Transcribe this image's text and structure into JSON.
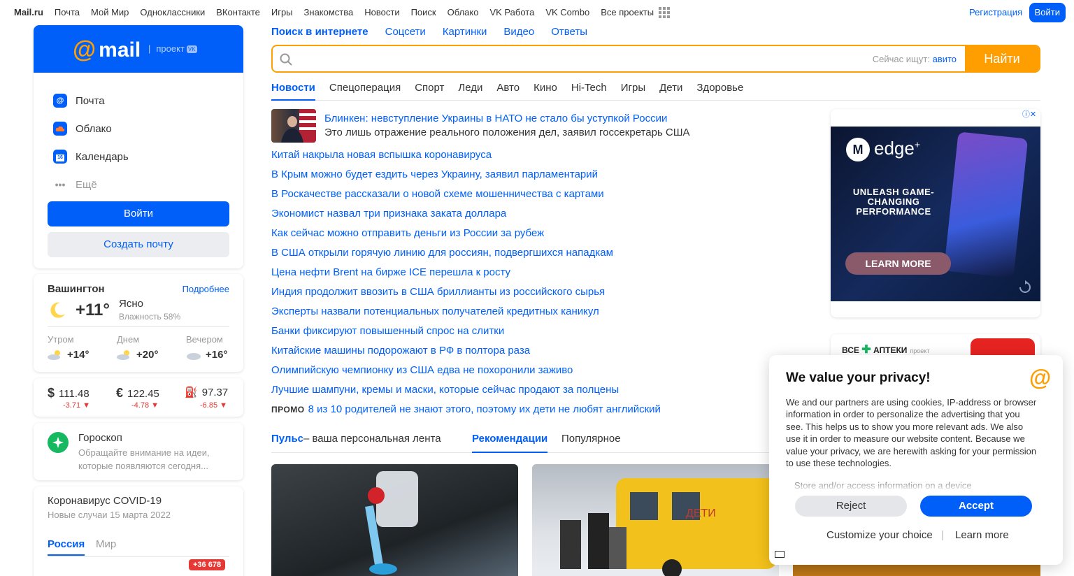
{
  "topnav": {
    "brand": "Mail.ru",
    "links": [
      "Почта",
      "Мой Мир",
      "Одноклассники",
      "ВКонтакте",
      "Игры",
      "Знакомства",
      "Новости",
      "Поиск",
      "Облако",
      "VK Работа",
      "VK Combo",
      "Все проекты"
    ],
    "register": "Регистрация",
    "login": "Войти"
  },
  "mail_card": {
    "logo_text": "mail",
    "project_text": "проект",
    "project_badge": "VK",
    "services": [
      {
        "label": "Почта",
        "icon": "mail-icon"
      },
      {
        "label": "Облако",
        "icon": "cloud-icon"
      },
      {
        "label": "Календарь",
        "icon": "calendar-icon"
      },
      {
        "label": "Ещё",
        "icon": "more-icon"
      }
    ],
    "login_button": "Войти",
    "create_button": "Создать почту"
  },
  "weather": {
    "city": "Вашингтон",
    "more": "Подробнее",
    "temp": "+11°",
    "desc": "Ясно",
    "humidity": "Влажность 58%",
    "periods": [
      {
        "label": "Утром",
        "temp": "+14°"
      },
      {
        "label": "Днем",
        "temp": "+20°"
      },
      {
        "label": "Вечером",
        "temp": "+16°"
      }
    ]
  },
  "rates": [
    {
      "symbol": "$",
      "value": "111.48",
      "change": "-3.71 ▼"
    },
    {
      "symbol": "€",
      "value": "122.45",
      "change": "-4.78 ▼"
    },
    {
      "symbol": "⛽",
      "value": "97.37",
      "change": "-6.85 ▼"
    }
  ],
  "horoscope": {
    "title": "Гороскоп",
    "text": "Обращайте внимание на идеи, которые появляются сегодня..."
  },
  "covid": {
    "title": "Коронавирус COVID-19",
    "subtitle": "Новые случаи 15 марта 2022",
    "tab_russia": "Россия",
    "tab_world": "Мир",
    "badge": "+36 678"
  },
  "search": {
    "tabs": [
      "Поиск в интернете",
      "Соцсети",
      "Картинки",
      "Видео",
      "Ответы"
    ],
    "hint_prefix": "Сейчас ищут:",
    "hint_value": "авито",
    "button": "Найти",
    "placeholder": ""
  },
  "news_tabs": [
    "Новости",
    "Спецоперация",
    "Спорт",
    "Леди",
    "Авто",
    "Кино",
    "Hi-Tech",
    "Игры",
    "Дети",
    "Здоровье"
  ],
  "lead": {
    "title": "Блинкен: невступление Украины в НАТО не стало бы уступкой России",
    "subtitle": "Это лишь отражение реального положения дел, заявил госсекретарь США"
  },
  "news": [
    "Китай накрыла новая вспышка коронавируса",
    "В Крым можно будет ездить через Украину, заявил парламентарий",
    "В Роскачестве рассказали о новой схеме мошенничества с картами",
    "Экономист назвал три признака заката доллара",
    "Как сейчас можно отправить деньги из России за рубеж",
    "В США открыли горячую линию для россиян, подвергшихся нападкам",
    "Цена нефти Brent на бирже ICE перешла к росту",
    "Индия продолжит ввозить в США бриллианты из российского сырья",
    "Эксперты назвали потенциальных получателей кредитных каникул",
    "Банки фиксируют повышенный спрос на слитки",
    "Китайские машины подорожают в РФ в полтора раза",
    "Олимпийскую чемпионку из США едва не похоронили заживо",
    "Лучшие шампуни, кремы и маски, которые сейчас продают за полцены"
  ],
  "promo": {
    "tag": "ПРОМО",
    "text": "8 из 10 родителей не знают этого, поэтому их дети не любят английский"
  },
  "pulse": {
    "brand": "Пульс",
    "desc": "– ваша персональная лента",
    "tab_rec": "Рекомендации",
    "tab_pop": "Популярное"
  },
  "ad1": {
    "brand": "edge",
    "brand_sup": "+",
    "brand_mark": "M",
    "headline": "UNLEASH GAME-CHANGING PERFORMANCE",
    "cta": "LEARN MORE",
    "info": "ⓘ✕"
  },
  "ad2": {
    "logo": "ВСЕ",
    "logo_plus": "✚",
    "logo_tail": "АПТЕКИ",
    "proj": "проект"
  },
  "privacy": {
    "title": "We value your privacy!",
    "logo": "@",
    "body": "We and our partners are using cookies, IP-address or browser information in order to personalize the advertising that you see. This helps us to show you more relevant ads. We also use it in order to measure our website content. Because we value your privacy, we are herewith asking for your permission to use these technologies.",
    "faded": "Store and/or access information on a device",
    "reject": "Reject",
    "accept": "Accept",
    "customize": "Customize your choice",
    "separator": "|",
    "learn": "Learn more"
  }
}
